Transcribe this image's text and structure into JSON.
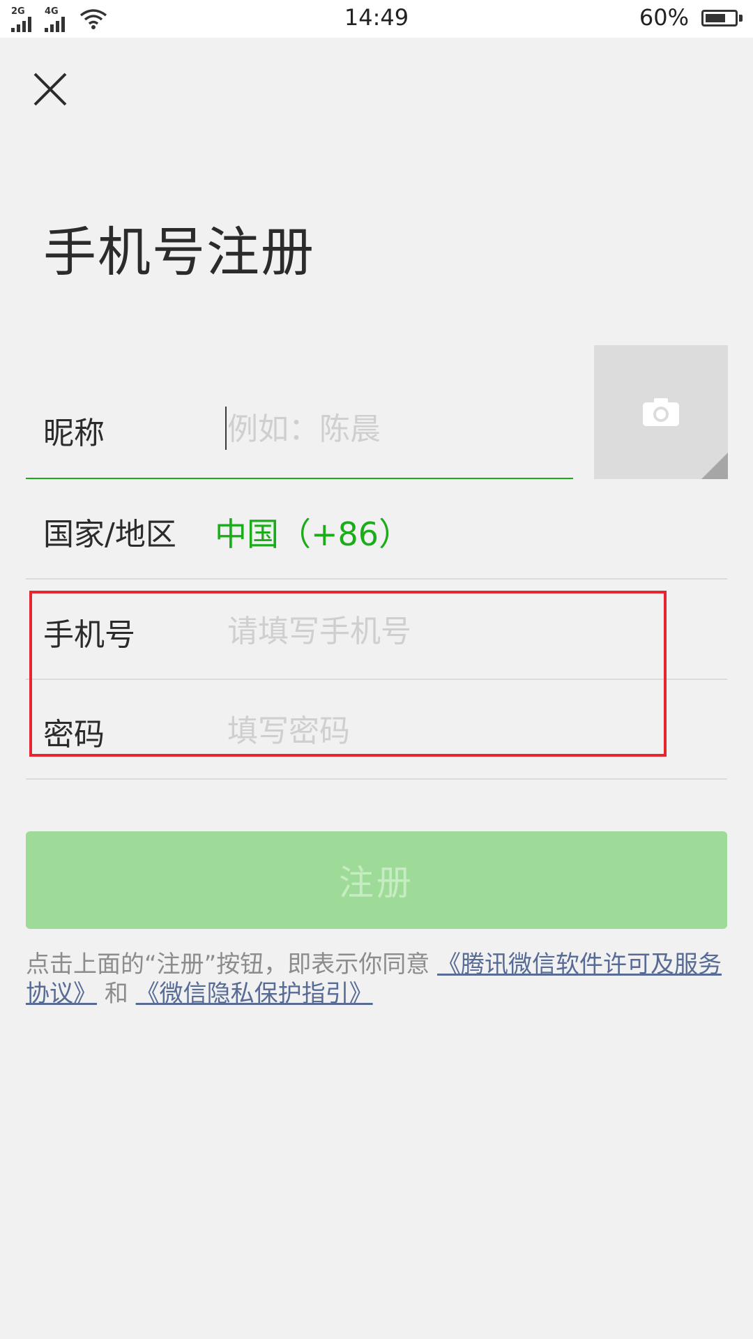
{
  "status_bar": {
    "net1": "2G",
    "net2": "4G",
    "time": "14:49",
    "battery": "60%",
    "battery_level": 0.6
  },
  "header": {
    "title": "手机号注册"
  },
  "form": {
    "nickname": {
      "label": "昵称",
      "placeholder": "例如：陈晨"
    },
    "country": {
      "label": "国家/地区",
      "value": "中国（+86）"
    },
    "phone": {
      "label": "手机号",
      "placeholder": "请填写手机号"
    },
    "password": {
      "label": "密码",
      "placeholder": "填写密码"
    }
  },
  "register_button": {
    "label": "注册"
  },
  "agreement": {
    "prefix": "点击上面的“注册”按钮，即表示你同意",
    "link1": "《腾讯微信软件许可及服务协议》",
    "middle": "和",
    "link2": "《微信隐私保护指引》"
  },
  "colors": {
    "accent": "#1aad19",
    "link": "#576b95",
    "button_disabled": "#9fdb98",
    "highlight": "#e6262f"
  },
  "icons": [
    "close-icon",
    "camera-icon",
    "wifi-icon",
    "battery-icon",
    "signal-icon"
  ]
}
